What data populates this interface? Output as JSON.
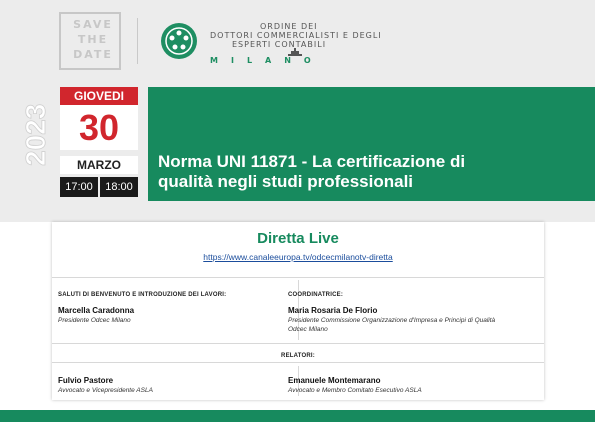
{
  "header": {
    "stamp_lines": [
      "SAVE",
      "THE",
      "DATE"
    ],
    "org_line1": "ORDINE DEI",
    "org_line2": "DOTTORI COMMERCIALISTI E DEGLI",
    "org_line3": "ESPERTI CONTABILI",
    "city": "MILANO"
  },
  "event": {
    "year": "2023",
    "weekday": "GIOVEDI",
    "day": "30",
    "month": "MARZO",
    "time_start": "17:00",
    "time_end": "18:00",
    "title_line1": "Norma UNI 11871 - La certificazione di",
    "title_line2": "qualità negli studi professionali"
  },
  "live": {
    "title": "Diretta Live",
    "url": "https://www.canaleeuropa.tv/odcecmilanotv-diretta"
  },
  "welcome": {
    "label": "SALUTI DI BENVENUTO E INTRODUZIONE DEI LAVORI:",
    "name": "Marcella Caradonna",
    "role": "Presidente Odcec Milano"
  },
  "coordinator": {
    "label": "COORDINATRICE:",
    "name": "Maria Rosaria De Florio",
    "role_line1": "Presidente Commissione Organizzazione d'Impresa e Principi di Qualità",
    "role_line2": "Odcec Milano"
  },
  "speakers": {
    "label": "RELATORI:",
    "items": [
      {
        "name": "Fulvio Pastore",
        "role": "Avvocato e Vicepresidente ASLA"
      },
      {
        "name": "Emanuele Montemarano",
        "role": "Avvocato e Membro Comitato Esecutivo ASLA"
      }
    ]
  },
  "colors": {
    "green": "#178a5e",
    "red": "#d1262d",
    "gray": "#ececec"
  }
}
